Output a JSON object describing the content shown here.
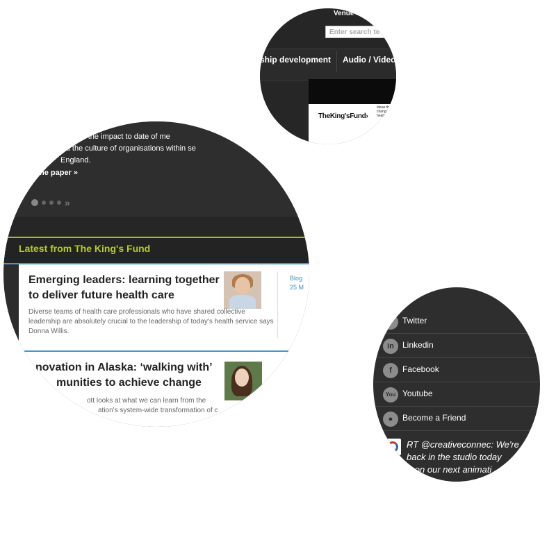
{
  "header": {
    "venue_text": "Venue h",
    "search_placeholder": "Enter search te",
    "nav_items": [
      "ship development",
      "Audio / Video"
    ],
    "logo_text": "TheKing'sFund›",
    "logo_small": "Ideas that change health care"
  },
  "slider": {
    "lines": [
      "ment of the impact to date of me",
      "ators and the culture of organisations within se",
      "England."
    ],
    "read_more": "he paper",
    "read_more_arrow": "»",
    "next_arrow": "»"
  },
  "latest": {
    "title": "Latest from The King's Fund",
    "card1": {
      "title": "Emerging leaders: learning together to deliver future health care",
      "body": "Diverse teams of health care professionals who have shared collective leadership are absolutely crucial to the leadership of today's health service says Donna Willis.",
      "meta_type": "Blog",
      "meta_date": "25 M"
    },
    "card2": {
      "title_l1": "novation in Alaska: ‘walking with’",
      "title_l2": "munities to achieve change",
      "body_l1": "ott looks at what we can learn from the",
      "body_l2": "ation's system-wide transformation of c"
    }
  },
  "social": {
    "items": [
      {
        "label": "Twitter",
        "icon": "twitter-icon",
        "glyph": "t"
      },
      {
        "label": "Linkedin",
        "icon": "linkedin-icon",
        "glyph": "in"
      },
      {
        "label": "Facebook",
        "icon": "facebook-icon",
        "glyph": "f"
      },
      {
        "label": "Youtube",
        "icon": "youtube-icon",
        "glyph": "You"
      },
      {
        "label": "Become a Friend",
        "icon": "person-icon",
        "glyph": "●"
      }
    ],
    "tweet": {
      "l1": "RT @creativeconnec: We're",
      "l2": "back in the studio today",
      "l3": "rking on our next animati"
    }
  },
  "colors": {
    "accent_green": "#b5cc2c",
    "accent_blue": "#3a9ad9",
    "dark_bg": "#2c2c2c"
  }
}
